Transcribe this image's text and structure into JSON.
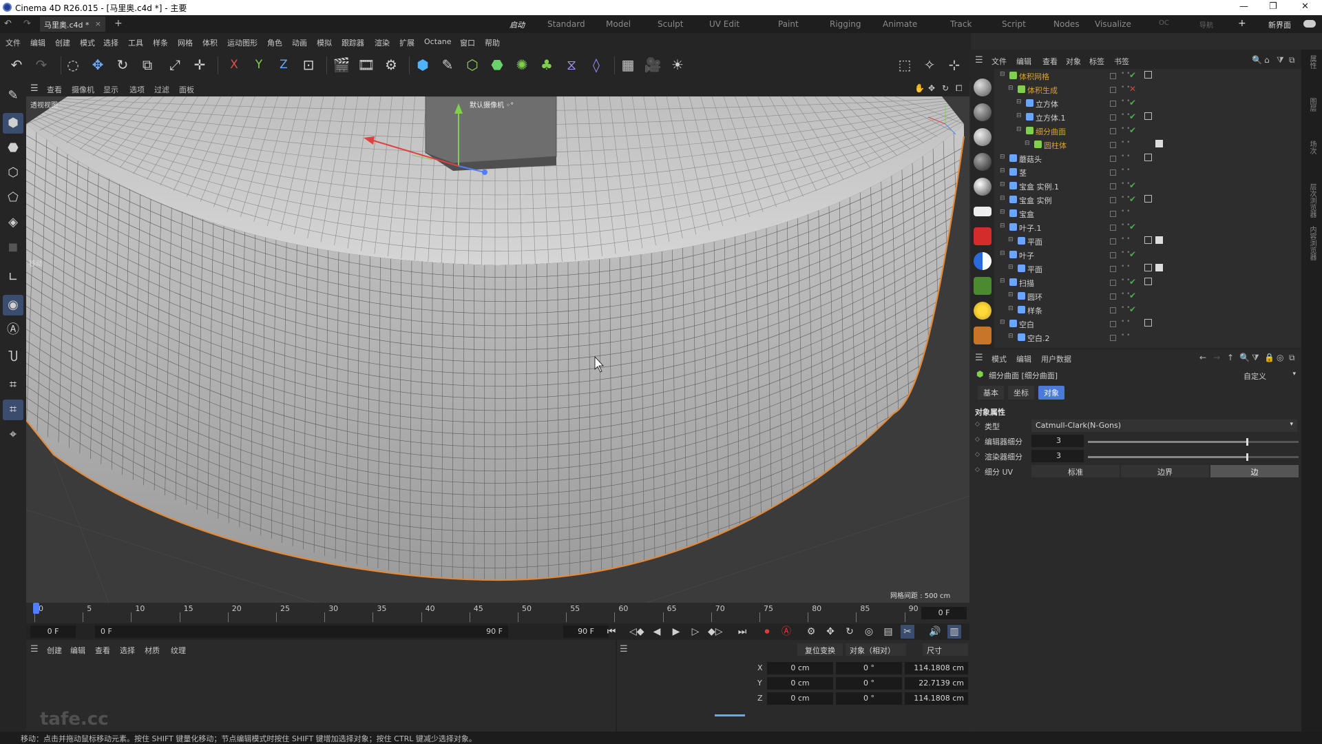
{
  "window": {
    "title": "Cinema 4D R26.015 - [马里奥.c4d *] - 主要",
    "controls": [
      "—",
      "❐",
      "✕"
    ]
  },
  "tabs": {
    "doc": "马里奥.c4d *",
    "layouts": [
      "启动",
      "Standard",
      "Model",
      "Sculpt",
      "UV Edit",
      "Paint",
      "Rigging",
      "Animate",
      "Track",
      "Script",
      "Nodes",
      "Visualize",
      "OC",
      "导航"
    ],
    "new_layout": "新界面"
  },
  "menu": [
    "文件",
    "编辑",
    "创建",
    "模式",
    "选择",
    "工具",
    "样条",
    "网格",
    "体积",
    "运动图形",
    "角色",
    "动画",
    "模拟",
    "跟踪器",
    "渲染",
    "扩展",
    "Octane",
    "窗口",
    "帮助"
  ],
  "axis_labels": [
    "X",
    "Y",
    "Z"
  ],
  "viewport": {
    "menu": [
      "查看",
      "摄像机",
      "显示",
      "选项",
      "过滤",
      "面板"
    ],
    "view_label": "透视视图",
    "camera_label": "默认摄像机 ◦°",
    "mode_label": "移动",
    "grid_info": "网格间距 : 500 cm",
    "colors": {
      "bg": "#3b3b3b",
      "mesh": "#a9a9a9",
      "outline": "#e2893a"
    }
  },
  "timeline": {
    "ticks": [
      "0",
      "5",
      "10",
      "15",
      "20",
      "25",
      "30",
      "35",
      "40",
      "45",
      "50",
      "55",
      "60",
      "65",
      "70",
      "75",
      "80",
      "85",
      "90"
    ],
    "current_frame": "0 F",
    "start_field": "0 F",
    "range_start": "0 F",
    "range_end": "90 F",
    "end_field": "90 F"
  },
  "bottom_menu": [
    "创建",
    "编辑",
    "查看",
    "选择",
    "材质",
    "纹理"
  ],
  "coords": {
    "reset_label": "复位变换",
    "mode_select": "对象（相对）",
    "size_select": "尺寸",
    "rows": [
      {
        "axis": "X",
        "pos": "0 cm",
        "rot": "0 °",
        "size": "114.1808 cm"
      },
      {
        "axis": "Y",
        "pos": "0 cm",
        "rot": "0 °",
        "size": "22.7139 cm"
      },
      {
        "axis": "Z",
        "pos": "0 cm",
        "rot": "0 °",
        "size": "114.1808 cm"
      }
    ]
  },
  "status_text": "移动：点击并拖动鼠标移动元素。按住 SHIFT 键量化移动；节点编辑模式时按住 SHIFT 键增加选择对象；按住 CTRL 键减少选择对象。",
  "watermark": "tafe.cc",
  "object_manager": {
    "menu": [
      "文件",
      "编辑",
      "查看",
      "对象",
      "标签",
      "书签"
    ],
    "objects": [
      {
        "name": "体积网格",
        "indent": 0,
        "color": "#d9a032",
        "check": "✔",
        "check_color": "#4caf50",
        "highlight": true
      },
      {
        "name": "体积生成",
        "indent": 1,
        "color": "#d9a032",
        "check": "✕",
        "check_color": "#e04040",
        "highlight": true
      },
      {
        "name": "立方体",
        "indent": 2,
        "color": "#d0d0d0",
        "check": "✔",
        "check_color": "#4caf50"
      },
      {
        "name": "立方体.1",
        "indent": 2,
        "color": "#d0d0d0",
        "check": "✔",
        "check_color": "#4caf50"
      },
      {
        "name": "细分曲面",
        "indent": 2,
        "color": "#d9a032",
        "check": "✔",
        "check_color": "#4caf50",
        "highlight": true
      },
      {
        "name": "圆柱体",
        "indent": 3,
        "color": "#d9a032",
        "check": "",
        "check_color": "#4caf50",
        "highlight": true
      },
      {
        "name": "蘑菇头",
        "indent": 0,
        "color": "#d0d0d0",
        "check": "",
        "check_color": "#4caf50"
      },
      {
        "name": "茎",
        "indent": 0,
        "color": "#d0d0d0",
        "check": "",
        "check_color": "#4caf50"
      },
      {
        "name": "宝盒 实例.1",
        "indent": 0,
        "color": "#d0d0d0",
        "check": "✔",
        "check_color": "#4caf50"
      },
      {
        "name": "宝盒 实例",
        "indent": 0,
        "color": "#d0d0d0",
        "check": "✔",
        "check_color": "#4caf50"
      },
      {
        "name": "宝盒",
        "indent": 0,
        "color": "#d0d0d0",
        "check": "",
        "check_color": "#4caf50"
      },
      {
        "name": "叶子.1",
        "indent": 0,
        "color": "#d0d0d0",
        "check": "✔",
        "check_color": "#4caf50"
      },
      {
        "name": "平面",
        "indent": 1,
        "color": "#d0d0d0",
        "check": "",
        "check_color": "#4caf50"
      },
      {
        "name": "叶子",
        "indent": 0,
        "color": "#d0d0d0",
        "check": "✔",
        "check_color": "#4caf50"
      },
      {
        "name": "平面",
        "indent": 1,
        "color": "#d0d0d0",
        "check": "",
        "check_color": "#4caf50"
      },
      {
        "name": "扫描",
        "indent": 0,
        "color": "#d0d0d0",
        "check": "✔",
        "check_color": "#4caf50"
      },
      {
        "name": "圆环",
        "indent": 1,
        "color": "#d0d0d0",
        "check": "✔",
        "check_color": "#4caf50"
      },
      {
        "name": "样条",
        "indent": 1,
        "color": "#d0d0d0",
        "check": "✔",
        "check_color": "#4caf50"
      },
      {
        "name": "空白",
        "indent": 0,
        "color": "#d0d0d0",
        "check": "",
        "check_color": "#4caf50"
      },
      {
        "name": "空白.2",
        "indent": 1,
        "color": "#d0d0d0",
        "check": "",
        "check_color": "#4caf50"
      }
    ]
  },
  "attributes": {
    "menu": [
      "模式",
      "编辑",
      "用户数据"
    ],
    "title": "细分曲面 [细分曲面]",
    "preset": "自定义",
    "tabs": [
      "基本",
      "坐标",
      "对象"
    ],
    "active_tab": "对象",
    "section": "对象属性",
    "type_label": "类型",
    "type_value": "Catmull-Clark(N-Gons)",
    "editor_label": "编辑器细分",
    "editor_value": "3",
    "editor_fraction": 0.75,
    "render_label": "渲染器细分",
    "render_value": "3",
    "render_fraction": 0.75,
    "uv_label": "细分 UV",
    "uv_options": [
      "标准",
      "边界",
      "边"
    ],
    "uv_selected": "边"
  },
  "side_labels": [
    "属性",
    "图层",
    "场次",
    "层次浏览器",
    "内容浏览器"
  ]
}
